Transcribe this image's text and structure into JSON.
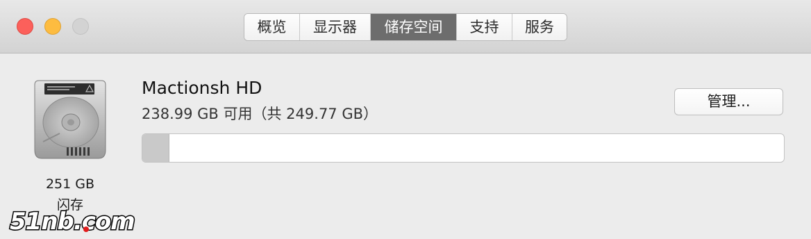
{
  "window": {
    "traffic_lights": {
      "close_color": "#fc605b",
      "minimize_color": "#fdbc40",
      "zoom_color": "#d3d3d3"
    }
  },
  "tabs": [
    {
      "label": "概览",
      "active": false
    },
    {
      "label": "显示器",
      "active": false
    },
    {
      "label": "储存空间",
      "active": true
    },
    {
      "label": "支持",
      "active": false
    },
    {
      "label": "服务",
      "active": false
    }
  ],
  "disk": {
    "icon": "hard-drive-icon",
    "size_label": "251 GB",
    "type_label": "闪存"
  },
  "volume": {
    "name": "Mactionsh HD",
    "capacity_text": "238.99 GB 可用（共 249.77 GB）",
    "used_fraction": 0.042
  },
  "manage_button": {
    "label": "管理..."
  },
  "watermark": {
    "text": "51nb.com"
  }
}
